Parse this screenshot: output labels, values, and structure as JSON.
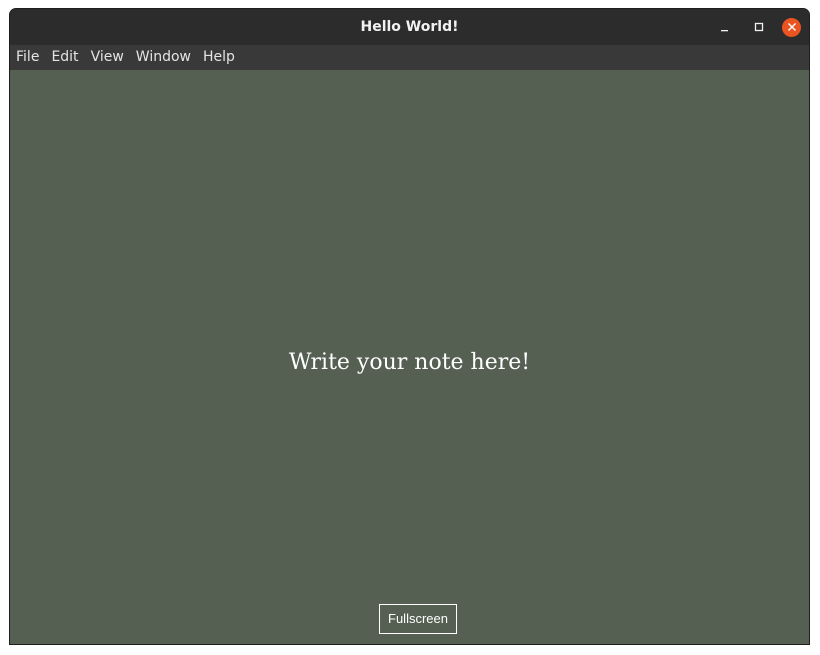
{
  "window": {
    "title": "Hello World!",
    "controls": {
      "minimize_icon": "minimize-icon",
      "maximize_icon": "maximize-icon",
      "close_icon": "close-icon"
    }
  },
  "menubar": {
    "items": [
      "File",
      "Edit",
      "View",
      "Window",
      "Help"
    ]
  },
  "main": {
    "note_text": "Write your note here!",
    "fullscreen_label": "Fullscreen"
  },
  "colors": {
    "background": "#555f52",
    "titlebar": "#2c2c2c",
    "menubar": "#393939",
    "close_button": "#e95420",
    "text": "#ffffff"
  }
}
